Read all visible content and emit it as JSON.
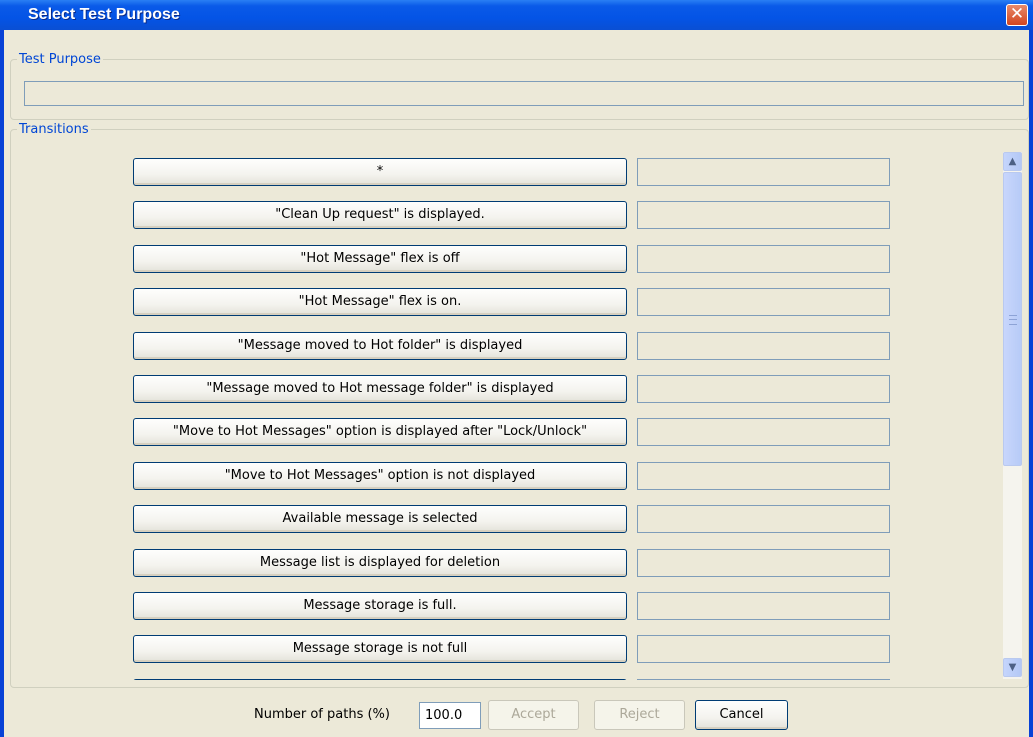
{
  "window": {
    "title": "Select Test Purpose",
    "close_glyph": "✕"
  },
  "test_purpose": {
    "legend": "Test Purpose",
    "value": ""
  },
  "transitions": {
    "legend": "Transitions",
    "items": [
      {
        "label": "*",
        "value": ""
      },
      {
        "label": "\"Clean Up request\" is displayed.",
        "value": ""
      },
      {
        "label": "\"Hot Message\" flex is off",
        "value": ""
      },
      {
        "label": "\"Hot Message\" flex is on.",
        "value": ""
      },
      {
        "label": "\"Message moved to Hot folder\" is displayed",
        "value": ""
      },
      {
        "label": "\"Message moved to Hot message folder\" is displayed",
        "value": ""
      },
      {
        "label": "\"Move to Hot Messages\" option is displayed after \"Lock/Unlock\"",
        "value": ""
      },
      {
        "label": "\"Move to Hot Messages\" option is not displayed",
        "value": ""
      },
      {
        "label": "Available message is selected",
        "value": ""
      },
      {
        "label": "Message list is displayed for deletion",
        "value": ""
      },
      {
        "label": "Message storage is full.",
        "value": ""
      },
      {
        "label": "Message storage is not full",
        "value": ""
      },
      {
        "label": "",
        "value": ""
      }
    ]
  },
  "scrollbar": {
    "up_glyph": "▲",
    "down_glyph": "▼"
  },
  "footer": {
    "paths_label": "Number of paths (%)",
    "paths_value": "100.0",
    "accept_label": "Accept",
    "reject_label": "Reject",
    "cancel_label": "Cancel"
  }
}
